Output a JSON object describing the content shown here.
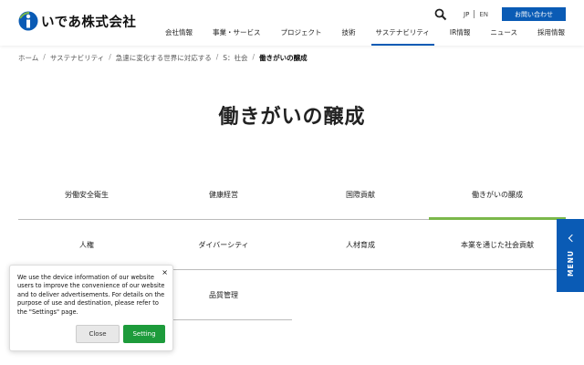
{
  "header": {
    "logo_text": "いであ株式会社",
    "lang": {
      "jp": "JP",
      "en": "EN"
    },
    "contact_label": "お問い合わせ",
    "nav": [
      {
        "label": "会社情報"
      },
      {
        "label": "事業・サービス"
      },
      {
        "label": "プロジェクト"
      },
      {
        "label": "技術"
      },
      {
        "label": "サステナビリティ",
        "active": true
      },
      {
        "label": "IR情報"
      },
      {
        "label": "ニュース"
      },
      {
        "label": "採用情報"
      }
    ]
  },
  "breadcrumb": [
    "ホーム",
    "サステナビリティ",
    "急速に変化する世界に対応する",
    "S：社会",
    "働きがいの醸成"
  ],
  "page_title": "働きがいの醸成",
  "tabs": [
    [
      "労働安全衛生",
      "健康経営",
      "国際貢献",
      "働きがいの醸成"
    ],
    [
      "人権",
      "ダイバーシティ",
      "人材育成",
      "本業を通じた社会貢献"
    ],
    [
      "",
      "品質管理"
    ]
  ],
  "active_tab": "働きがいの醸成",
  "side_menu_label": "MENU",
  "cookie": {
    "text": "We use the device information of our website users to improve the convenience of our website and to deliver advertisements. For details on the purpose of use and destination, please refer to the \"Settings\" page.",
    "close_x": "×",
    "close_label": "Close",
    "setting_label": "Setting"
  },
  "colors": {
    "brand_blue": "#0a5bb5",
    "active_green": "#7bb84a",
    "setting_green": "#1d9b3b"
  }
}
